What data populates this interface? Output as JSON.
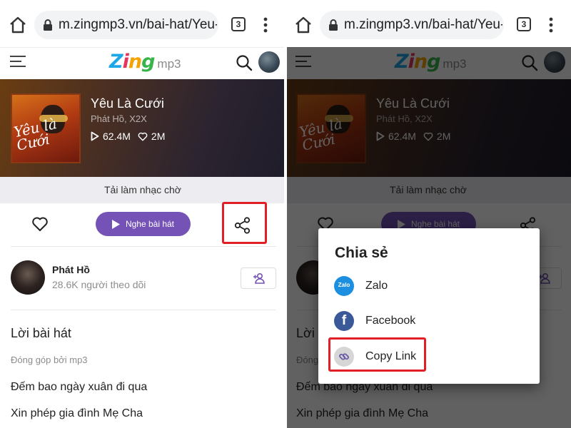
{
  "browser": {
    "url": "m.zingmp3.vn/bai-hat/Yeu-l",
    "tab_count": "3"
  },
  "header": {
    "logo_zing": "Zing",
    "logo_mp3": "mp3"
  },
  "song": {
    "title": "Yêu Là Cưới",
    "artists": "Phát Hồ, X2X",
    "plays": "62.4M",
    "likes": "2M",
    "cover_script": "Yêu là Cưới"
  },
  "ringtone_label": "Tải làm nhạc chờ",
  "actions": {
    "play_label": "Nghe bài hát"
  },
  "artist": {
    "name": "Phát Hồ",
    "followers": "28.6K người theo dõi"
  },
  "lyrics": {
    "heading": "Lời bài hát",
    "contributed_by": "Đóng góp bởi  mp3",
    "lines": [
      "Đếm bao ngày xuân đi qua",
      "Xin phép gia đình Mẹ Cha"
    ]
  },
  "share_dialog": {
    "title": "Chia sẻ",
    "options": [
      {
        "label": "Zalo",
        "icon": "zalo-icon",
        "icon_text": "Zalo"
      },
      {
        "label": "Facebook",
        "icon": "facebook-icon",
        "icon_text": "f"
      },
      {
        "label": "Copy Link",
        "icon": "link-icon"
      }
    ]
  },
  "colors": {
    "accent_purple": "#7552b5",
    "highlight_red": "#e21e26",
    "ringtone_bg": "#ececf1",
    "zalo_blue": "#1d8fe1",
    "facebook_blue": "#3b5998"
  }
}
